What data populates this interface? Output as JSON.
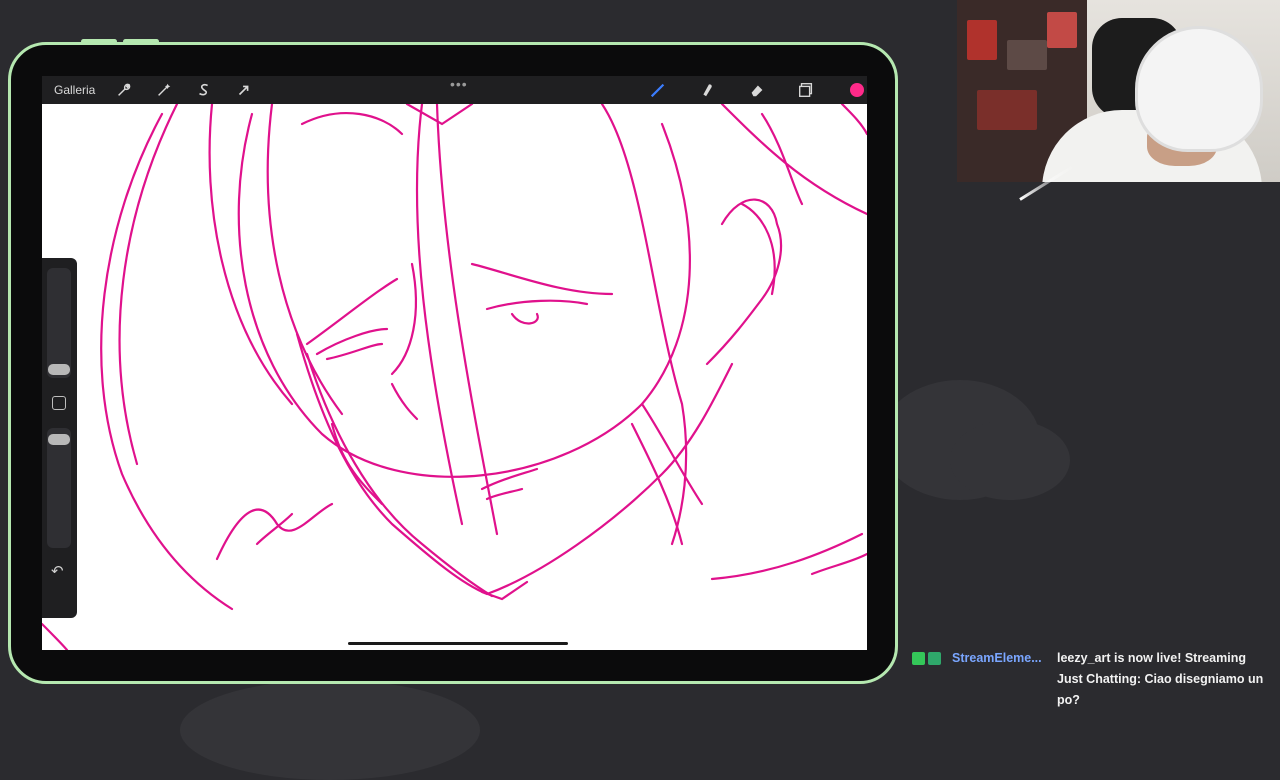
{
  "procreate": {
    "gallery_label": "Galleria",
    "toolbar_left_icons": [
      "wrench-icon",
      "magic-wand-icon",
      "selection-s-icon",
      "arrow-transform-icon"
    ],
    "toolbar_right_icons": [
      "brush-icon",
      "smudge-icon",
      "eraser-icon",
      "layers-icon"
    ],
    "more_label": "•••",
    "active_color": "#ff2a8a",
    "undo_icon": "↶"
  },
  "chat": {
    "username": "StreamEleme...",
    "message": "leezy_art is now live! Streaming Just Chatting: Ciao disegniamo un po?"
  },
  "colors": {
    "ipad_frame": "#b5e8b0",
    "sketch_stroke": "#e0118c",
    "background": "#2b2b2f",
    "username": "#7aa6ff"
  }
}
